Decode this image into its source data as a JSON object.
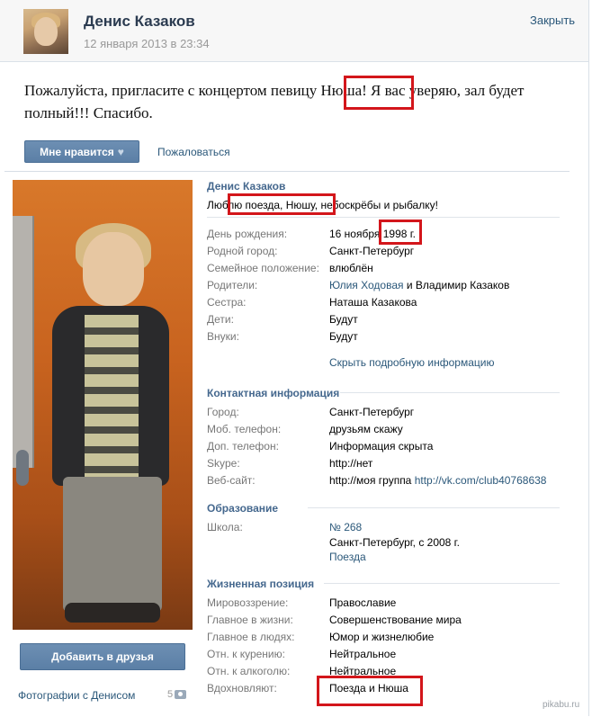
{
  "post": {
    "author": "Денис Казаков",
    "date": "12 января 2013 в 23:34",
    "close_label": "Закрыть",
    "text": "Пожалуйста, пригласите с концертом певицу Нюша! Я вас уверяю, зал будет полный!!! Спасибо.",
    "like_label": "Мне нравится",
    "report_label": "Пожаловаться"
  },
  "profile": {
    "name": "Денис Казаков",
    "status": "Люблю поезда, Нюшу, небоскрёбы и рыбалку!",
    "add_friend_label": "Добавить в друзья",
    "photos_label": "Фотографии с Денисом",
    "photos_count": "5",
    "hide_info_label": "Скрыть подробную информацию",
    "info": [
      {
        "label": "День рождения:",
        "value": "16 ноября 1998 г."
      },
      {
        "label": "Родной город:",
        "value": "Санкт-Петербург"
      },
      {
        "label": "Семейное положение:",
        "value": "влюблён"
      },
      {
        "label": "Родители:",
        "value": "Юлия Ходовая",
        "value_and": " и ",
        "value2": "Владимир Казаков"
      },
      {
        "label": "Сестра:",
        "value": "Наташа Казакова"
      },
      {
        "label": "Дети:",
        "value": "Будут"
      },
      {
        "label": "Внуки:",
        "value": "Будут"
      }
    ],
    "contact_title": "Контактная информация",
    "contacts": [
      {
        "label": "Город:",
        "value": "Санкт-Петербург"
      },
      {
        "label": "Моб. телефон:",
        "value": "друзьям скажу"
      },
      {
        "label": "Доп. телефон:",
        "value": "Информация скрыта"
      },
      {
        "label": "Skype:",
        "value": "http://нет"
      },
      {
        "label": "Веб-сайт:",
        "value": "http://моя группа",
        "value2": "http://vk.com/club40768638"
      }
    ],
    "education_title": "Образование",
    "school_label": "Школа:",
    "school_lines": [
      "№ 268",
      "Санкт-Петербург, с 2008 г.",
      "Поезда"
    ],
    "life_title": "Жизненная позиция",
    "life": [
      {
        "label": "Мировоззрение:",
        "value": "Православие"
      },
      {
        "label": "Главное в жизни:",
        "value": "Совершенствование мира"
      },
      {
        "label": "Главное в людях:",
        "value": "Юмор и жизнелюбие"
      },
      {
        "label": "Отн. к курению:",
        "value": "Нейтральное"
      },
      {
        "label": "Отн. к алкоголю:",
        "value": "Нейтральное"
      },
      {
        "label": "Вдохновляют:",
        "value": "Поезда и Нюша"
      }
    ]
  },
  "watermark": "pikabu.ru",
  "colors": {
    "link": "#2b587a",
    "section": "#45688e",
    "highlight": "#d3161b",
    "button": "#5b7fa6"
  }
}
